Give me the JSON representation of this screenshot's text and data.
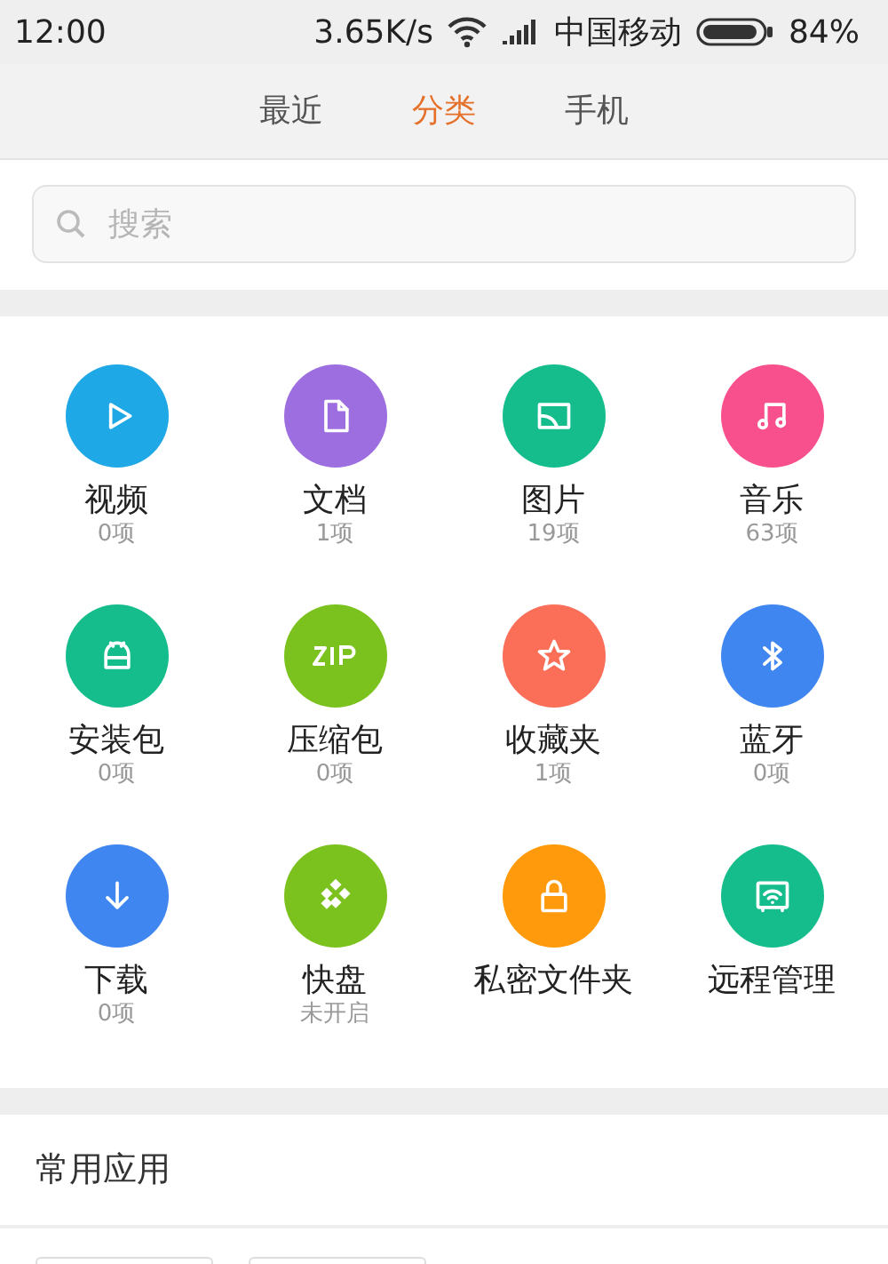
{
  "status_bar": {
    "time": "12:00",
    "speed": "3.65K/s",
    "carrier": "中国移动",
    "battery": "84%"
  },
  "tabs": [
    {
      "label": "最近",
      "selected": false
    },
    {
      "label": "分类",
      "selected": true
    },
    {
      "label": "手机",
      "selected": false
    }
  ],
  "search": {
    "placeholder": "搜索"
  },
  "categories": [
    {
      "label": "视频",
      "count": "0项",
      "color": "#1ea8e6"
    },
    {
      "label": "文档",
      "count": "1项",
      "color": "#9d6ee0"
    },
    {
      "label": "图片",
      "count": "19项",
      "color": "#15bd8c"
    },
    {
      "label": "音乐",
      "count": "63项",
      "color": "#f7508c"
    },
    {
      "label": "安装包",
      "count": "0项",
      "color": "#15bd8c"
    },
    {
      "label": "压缩包",
      "count": "0项",
      "color": "#7cc21f"
    },
    {
      "label": "收藏夹",
      "count": "1项",
      "color": "#fb6e58"
    },
    {
      "label": "蓝牙",
      "count": "0项",
      "color": "#3f86f0"
    },
    {
      "label": "下载",
      "count": "0项",
      "color": "#3f86f0"
    },
    {
      "label": "快盘",
      "count": "未开启",
      "color": "#7cc21f"
    },
    {
      "label": "私密文件夹",
      "color": "#fe9a0c"
    },
    {
      "label": "远程管理",
      "color": "#15bd8c"
    }
  ],
  "section": {
    "title": "常用应用"
  }
}
